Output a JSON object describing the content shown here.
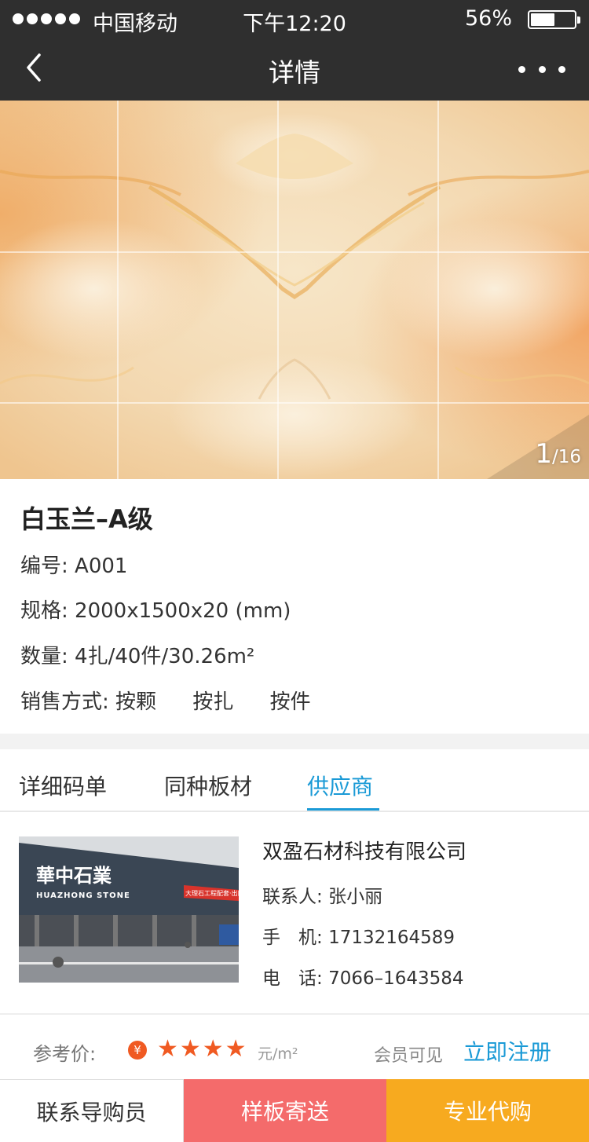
{
  "status_bar": {
    "carrier": "中国移动",
    "time": "下午12:20",
    "battery_percent": "56%",
    "battery_level": 0.56
  },
  "nav": {
    "title": "详情",
    "back_icon": "chevron-left-icon",
    "more_icon": "more-dots-icon"
  },
  "gallery": {
    "current": "1",
    "total": "/16"
  },
  "product": {
    "title": "白玉兰–A级",
    "code_label": "编号:",
    "code_value": "A001",
    "spec_label": "规格:",
    "spec_value": "2000x1500x20 (mm)",
    "qty_label": "数量:",
    "qty_value": "4扎/40件/30.26m²",
    "sales_label": "销售方式:",
    "sales_methods": [
      "按颗",
      "按扎",
      "按件"
    ]
  },
  "tabs": [
    {
      "label": "详细码单",
      "active": false
    },
    {
      "label": "同种板材",
      "active": false
    },
    {
      "label": "供应商",
      "active": true
    }
  ],
  "supplier": {
    "name": "双盈石材科技有限公司",
    "contact_label": "联系人:",
    "contact_value": "张小丽",
    "mobile_label": "手　机:",
    "mobile_value": "17132164589",
    "phone_label": "电　话:",
    "phone_value": "7066–1643584",
    "photo_sign_cn": "華中石業",
    "photo_sign_en": "HUAZHONG STONE",
    "photo_banner": "大理石工程配套·出口服务"
  },
  "price": {
    "label": "参考价:",
    "currency_icon": "yen-icon",
    "masked_value": "★★★★",
    "unit": "元/m²",
    "member_note": "会员可见",
    "register_label": "立即注册"
  },
  "actions": {
    "contact": "联系导购员",
    "sample": "样板寄送",
    "purchase": "专业代购"
  },
  "colors": {
    "nav_bg": "#2f2f2f",
    "accent_blue": "#1a9ad6",
    "price_orange": "#f05a22",
    "sample_red": "#f46b6b",
    "purchase_orange": "#f7aa1f"
  }
}
